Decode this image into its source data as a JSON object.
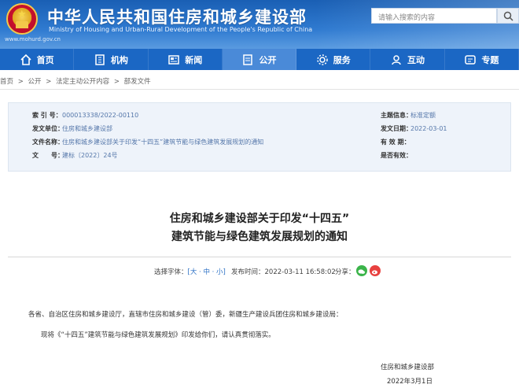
{
  "header": {
    "title": "中华人民共和国住房和城乡建设部",
    "subtitle": "Ministry of Housing and Urban-Rural Development of the People's Republic of China",
    "url": "www.mohurd.gov.cn",
    "search_placeholder": "请输入搜索的内容"
  },
  "nav": [
    {
      "label": "首页",
      "icon": "home-icon"
    },
    {
      "label": "机构",
      "icon": "building-icon"
    },
    {
      "label": "新闻",
      "icon": "news-icon"
    },
    {
      "label": "公开",
      "icon": "document-icon"
    },
    {
      "label": "服务",
      "icon": "gear-icon"
    },
    {
      "label": "互动",
      "icon": "chat-icon"
    },
    {
      "label": "专题",
      "icon": "topic-icon"
    }
  ],
  "breadcrumb": [
    "首页",
    ">",
    "公开",
    ">",
    "法定主动公开内容",
    ">",
    "部发文件"
  ],
  "info": {
    "index_label": "索 引 号：",
    "index_value": "000013338/2022-00110",
    "unit_label": "发文单位：",
    "unit_value": "住房和城乡建设部",
    "name_label": "文件名称：",
    "name_value": "住房和城乡建设部关于印发“十四五”建筑节能与绿色建筑发展规划的通知",
    "num_label": "文　　号：",
    "num_value": "建标〔2022〕24号",
    "cat_label": "主题信息：",
    "cat_value": "标准定额",
    "date_label": "发文日期：",
    "date_value": "2022-03-01",
    "valid_label": "有 效 期：",
    "valid_value": "",
    "status_label": "是否有效：",
    "status_value": ""
  },
  "article": {
    "title_line1": "住房和城乡建设部关于印发“十四五”",
    "title_line2": "建筑节能与绿色建筑发展规划的通知",
    "font_label": "选择字体：",
    "font_sizes": "[大 · 中 · 小]",
    "pub_label": "发布时间：",
    "pub_time": "2022-03-11 16:58:02",
    "share_label": "分享：",
    "recipients": "各省、自治区住房和城乡建设厅，直辖市住房和城乡建设（管）委，新疆生产建设兵团住房和城乡建设局：",
    "body": "现将《“十四五”建筑节能与绿色建筑发展规划》印发给你们，请认真贯彻落实。",
    "signature": "住房和城乡建设部",
    "sign_date": "2022年3月1日"
  },
  "colors": {
    "header_blue": "#1a5fb4",
    "nav_blue": "#1b67c4",
    "nav_active": "#4a8ad8",
    "info_bg": "#eef3fa",
    "link_blue": "#2a6fc4"
  }
}
